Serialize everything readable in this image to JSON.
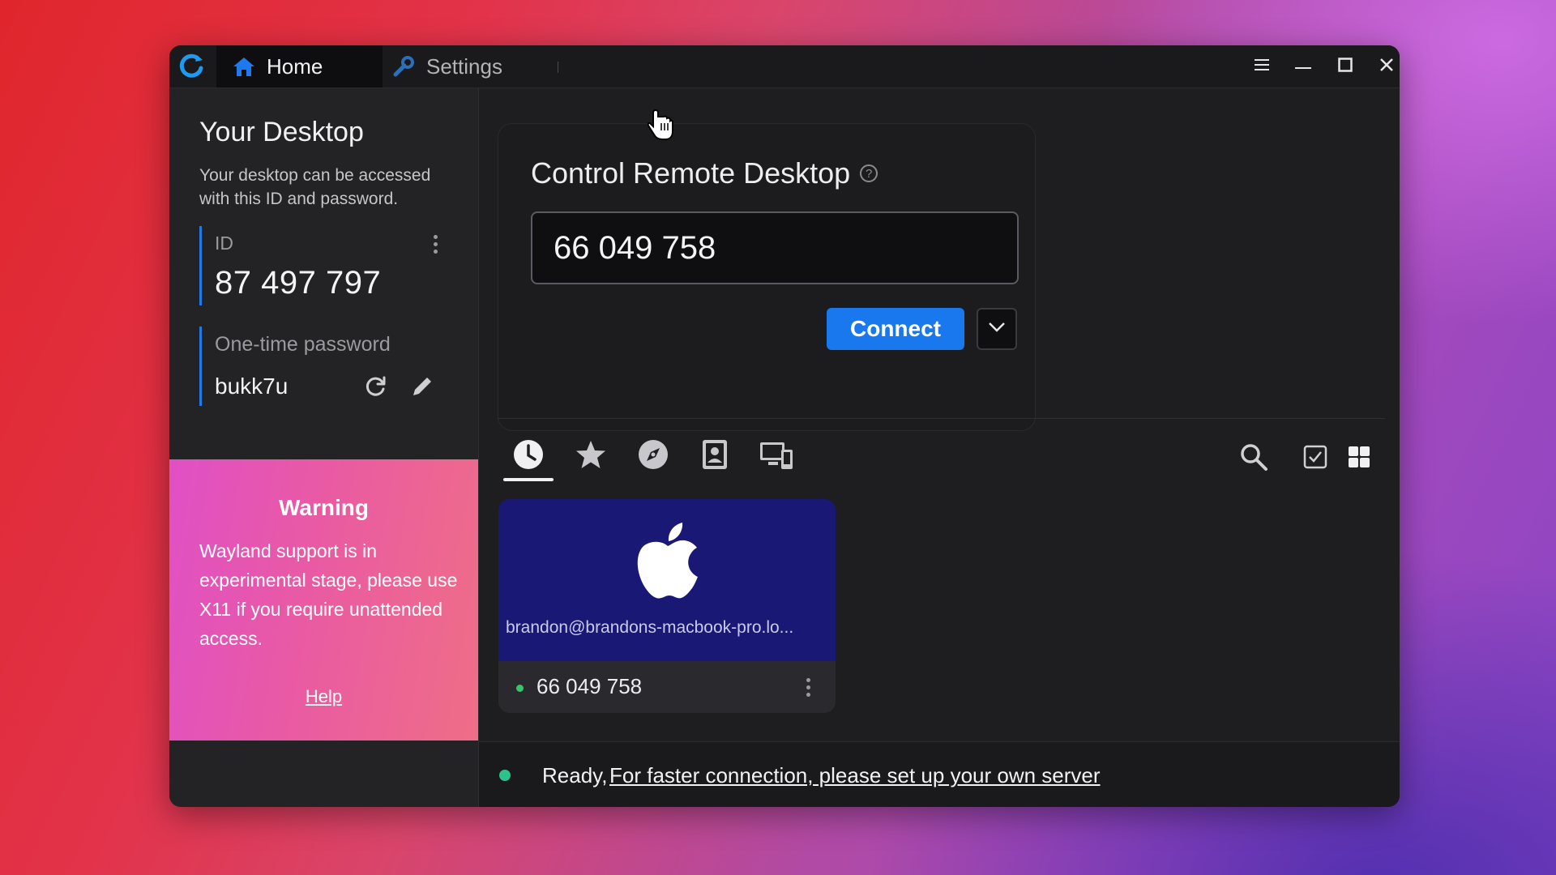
{
  "app": {
    "logo_icon": "rustdesk-logo-icon",
    "accent": "#1a78ee"
  },
  "tabs": [
    {
      "label": "Home",
      "icon": "home-icon",
      "active": true
    },
    {
      "label": "Settings",
      "icon": "wrench-icon",
      "active": false
    }
  ],
  "window_controls": [
    "menu-icon",
    "minimize-icon",
    "maximize-icon",
    "close-icon"
  ],
  "sidebar": {
    "title": "Your Desktop",
    "description": "Your desktop can be accessed with this ID and password.",
    "id_label": "ID",
    "id_value": "87 497 797",
    "password_label": "One-time password",
    "password_value": "bukk7u"
  },
  "warning": {
    "title": "Warning",
    "text": "Wayland support is in experimental stage, please use X11 if you require unattended access.",
    "help_label": "Help"
  },
  "remote": {
    "title": "Control Remote Desktop",
    "input_value": "66 049 758",
    "connect_label": "Connect"
  },
  "peer_tabs": [
    {
      "name": "recent-icon",
      "active": true
    },
    {
      "name": "favorites-star-icon",
      "active": false
    },
    {
      "name": "discovered-compass-icon",
      "active": false
    },
    {
      "name": "address-book-icon",
      "active": false
    },
    {
      "name": "devices-icon",
      "active": false
    }
  ],
  "peer_tools": [
    "search-icon",
    "select-checkbox-icon",
    "grid-view-icon"
  ],
  "peers": [
    {
      "os_icon": "apple-icon",
      "name": "brandon@brandons-macbook-pro.lo...",
      "id": "66 049 758",
      "online": true
    }
  ],
  "status": {
    "text": "Ready,",
    "link": "For faster connection, please set up your own server",
    "color": "#2bc28c"
  }
}
